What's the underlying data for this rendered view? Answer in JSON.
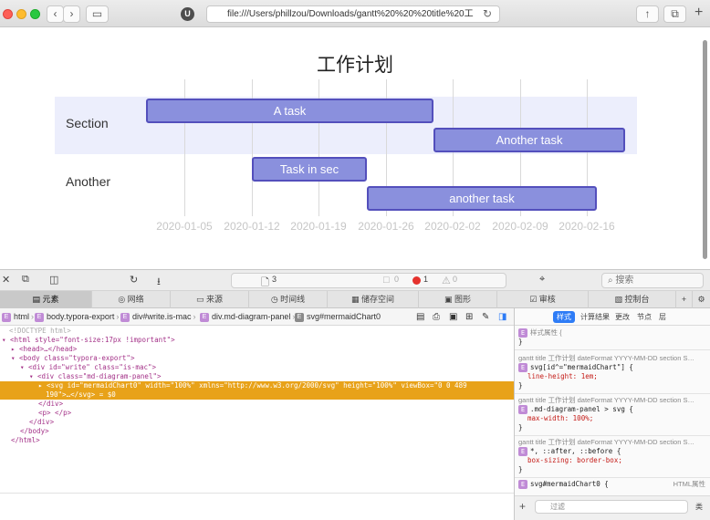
{
  "browser": {
    "url": "file:///Users/phillzou/Downloads/gantt%20%20%20title%20工"
  },
  "gantt": {
    "title": "工作计划",
    "sections": [
      "Section",
      "Another"
    ],
    "tasks": [
      {
        "label": "A task",
        "start": "2020-01-01",
        "end": "2020-01-31"
      },
      {
        "label": "Another task",
        "start": "2020-01-31",
        "end": "2020-02-20"
      },
      {
        "label": "Task in sec",
        "start": "2020-01-12",
        "end": "2020-01-24"
      },
      {
        "label": "another task",
        "start": "2020-01-24",
        "end": "2020-02-17"
      }
    ],
    "ticks": [
      "2020-01-05",
      "2020-01-12",
      "2020-01-19",
      "2020-01-26",
      "2020-02-02",
      "2020-02-09",
      "2020-02-16"
    ]
  },
  "devtools": {
    "toolbar": {
      "resources_count": "3",
      "errors_count": "1",
      "warnings_count": "0",
      "logs_count": "0",
      "search_placeholder": "搜索"
    },
    "tabs": [
      "元素",
      "网络",
      "来源",
      "时间线",
      "储存空间",
      "图形",
      "审核",
      "控制台"
    ],
    "breadcrumbs": [
      "html",
      "body.typora-export",
      "div#write.is-mac",
      "div.md-diagram-panel",
      "svg#mermaidChart0"
    ],
    "dom": [
      "<!DOCTYPE html>",
      "<html style=\"font-size:17px !important\">",
      "<head>…</head>",
      "<body class=\"typora-export\">",
      "<div id=\"write\" class=\"is-mac\">",
      "<div class=\"md-diagram-panel\">",
      "<svg id=\"mermaidChart0\" width=\"100%\" xmlns=\"http://www.w3.org/2000/svg\" height=\"100%\" viewBox=\"0 0 489",
      "190\">…</svg> = $0",
      "</div>",
      "<p> </p>",
      "</div>",
      "</body>",
      "</html>"
    ],
    "styles": {
      "tabs": [
        "样式",
        "计算结果",
        "更改",
        "节点",
        "层"
      ],
      "header": "样式属性 {",
      "rules": [
        {
          "source": "gantt title 工作计划 dateFormat YYYY-MM-DD section S…",
          "selector": "svg[id^=\"mermaidChart\"] {",
          "prop": "line-height: 1em;"
        },
        {
          "source": "gantt title 工作计划 dateFormat YYYY-MM-DD section S…",
          "selector": ".md-diagram-panel > svg {",
          "prop": "max-width: 100%;"
        },
        {
          "source": "gantt title 工作计划 dateFormat YYYY-MM-DD section S…",
          "selector": "*, ::after, ::before {",
          "prop": "box-sizing: border-box;"
        }
      ],
      "last_selector": "svg#mermaidChart0 {",
      "last_source": "HTML属性",
      "filter_placeholder": "过滤",
      "class_label": "类"
    }
  }
}
